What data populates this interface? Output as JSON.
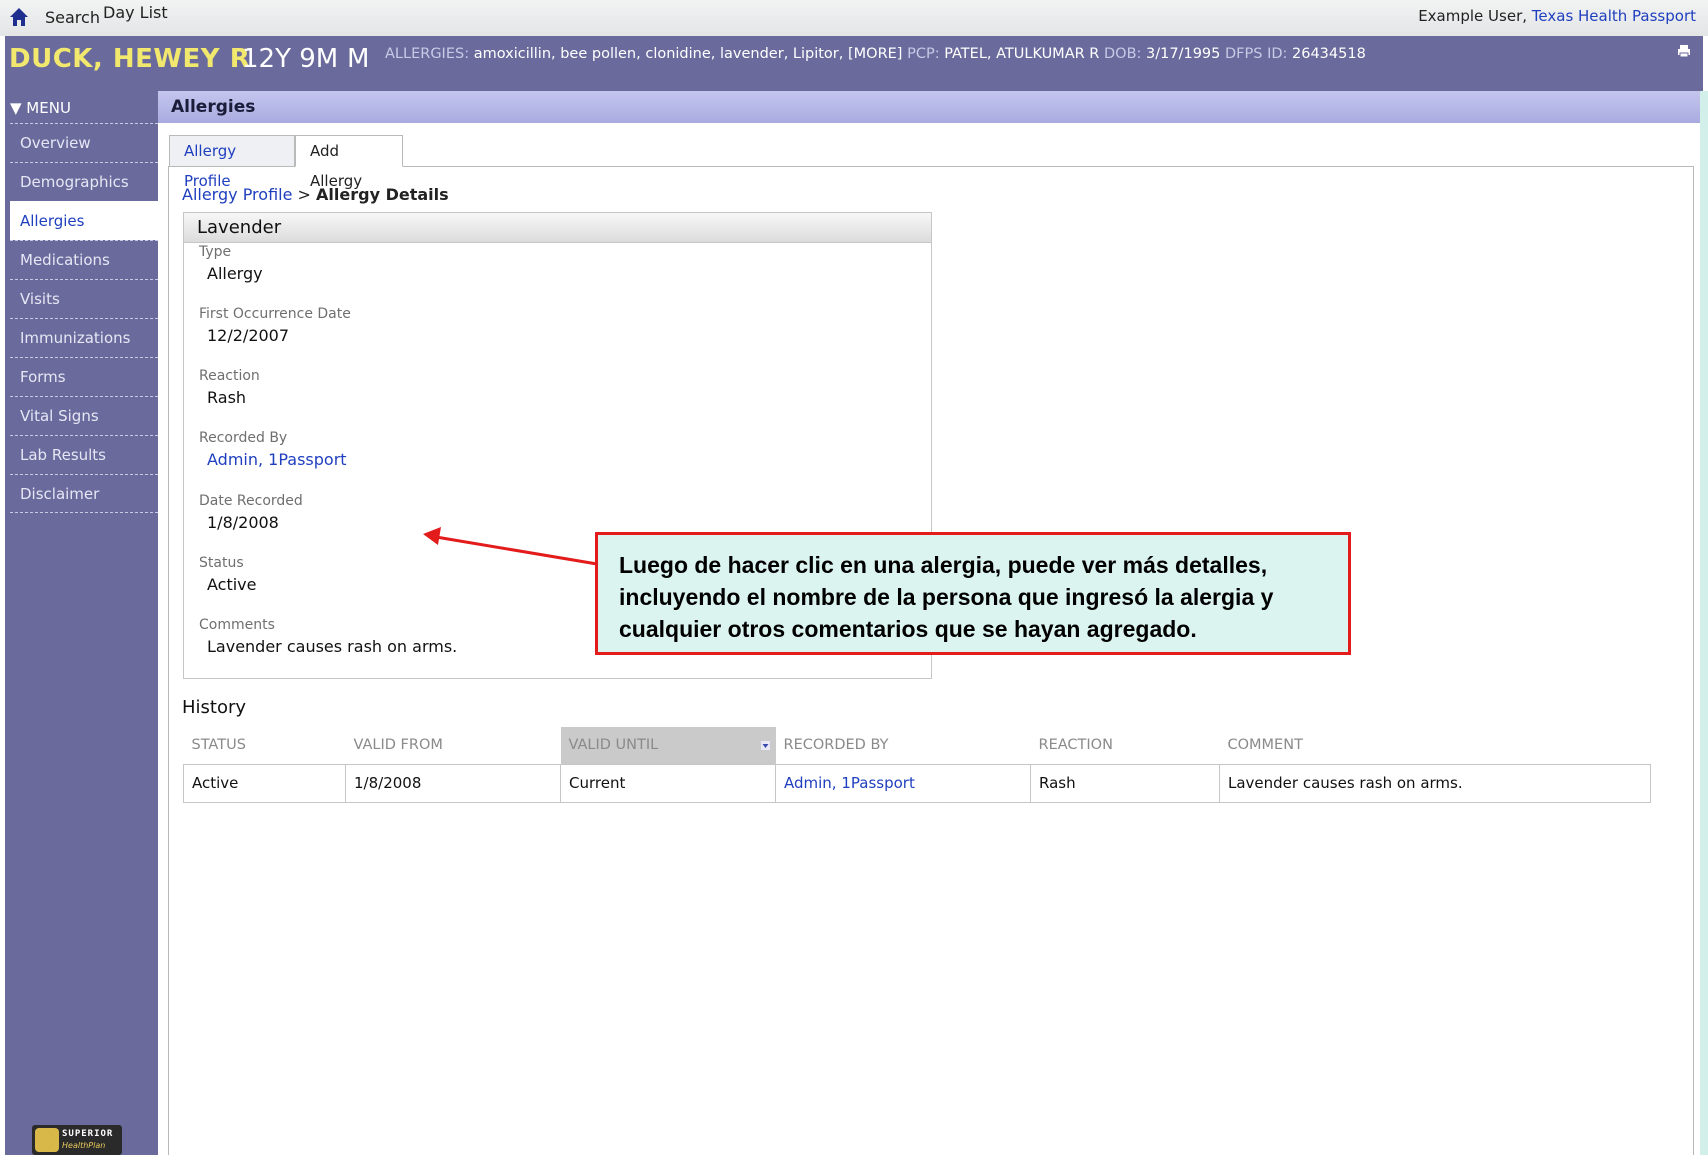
{
  "topbar": {
    "search_label": "Search",
    "daylist_label": "Day List",
    "user_label": "Example User,",
    "org_label": "Texas Health Passport"
  },
  "patient": {
    "name": "DUCK, HEWEY R",
    "age": "12Y 9M",
    "sex": "M",
    "allergies_label": "ALLERGIES:",
    "allergies_value": "amoxicillin, bee pollen, clonidine, lavender, Lipitor, [MORE]",
    "pcp_label": "PCP:",
    "pcp_value": "PATEL, ATULKUMAR R",
    "dob_label": "DOB:",
    "dob_value": "3/17/1995",
    "dfps_label": "DFPS ID:",
    "dfps_value": "26434518"
  },
  "sidebar": {
    "menu_label": "▼ MENU",
    "items": [
      {
        "label": "Overview"
      },
      {
        "label": "Demographics"
      },
      {
        "label": "Allergies"
      },
      {
        "label": "Medications"
      },
      {
        "label": "Visits"
      },
      {
        "label": "Immunizations"
      },
      {
        "label": "Forms"
      },
      {
        "label": "Vital Signs"
      },
      {
        "label": "Lab Results"
      },
      {
        "label": "Disclaimer"
      }
    ],
    "logo_text": "SUPERIOR",
    "logo_sub": "HealthPlan"
  },
  "section": {
    "title": "Allergies"
  },
  "tabs": {
    "profile": "Allergy Profile",
    "add": "Add Allergy"
  },
  "breadcrumb": {
    "link": "Allergy Profile",
    "sep": ">",
    "current": "Allergy Details"
  },
  "details": {
    "title": "Lavender",
    "type_label": "Type",
    "type_value": "Allergy",
    "first_label": "First Occurrence Date",
    "first_value": "12/2/2007",
    "reaction_label": "Reaction",
    "reaction_value": "Rash",
    "recorded_by_label": "Recorded By",
    "recorded_by_value": "Admin, 1Passport",
    "date_recorded_label": "Date Recorded",
    "date_recorded_value": "1/8/2008",
    "status_label": "Status",
    "status_value": "Active",
    "comments_label": "Comments",
    "comments_value": "Lavender causes rash on arms."
  },
  "history": {
    "title": "History",
    "columns": [
      "STATUS",
      "VALID FROM",
      "VALID UNTIL",
      "RECORDED BY",
      "REACTION",
      "COMMENT"
    ],
    "rows": [
      [
        "Active",
        "1/8/2008",
        "Current",
        "Admin, 1Passport",
        "Rash",
        "Lavender causes rash on arms."
      ]
    ]
  },
  "callout": {
    "text": "Luego de hacer clic en una alergia, puede ver más detalles, incluyendo el nombre de la persona que ingresó la alergia y cualquier otros comentarios que se hayan agregado.",
    "border_color": "#e31b1b",
    "fill_color": "#dcf4ef"
  },
  "colors": {
    "patient_bar": "#6a6b9c",
    "patient_name": "#f2e86e",
    "link": "#1f3fbf",
    "section_header": "#b4b6e6"
  },
  "icons": {
    "home": "home-icon",
    "print": "print-icon",
    "sort": "sort-desc-icon"
  }
}
